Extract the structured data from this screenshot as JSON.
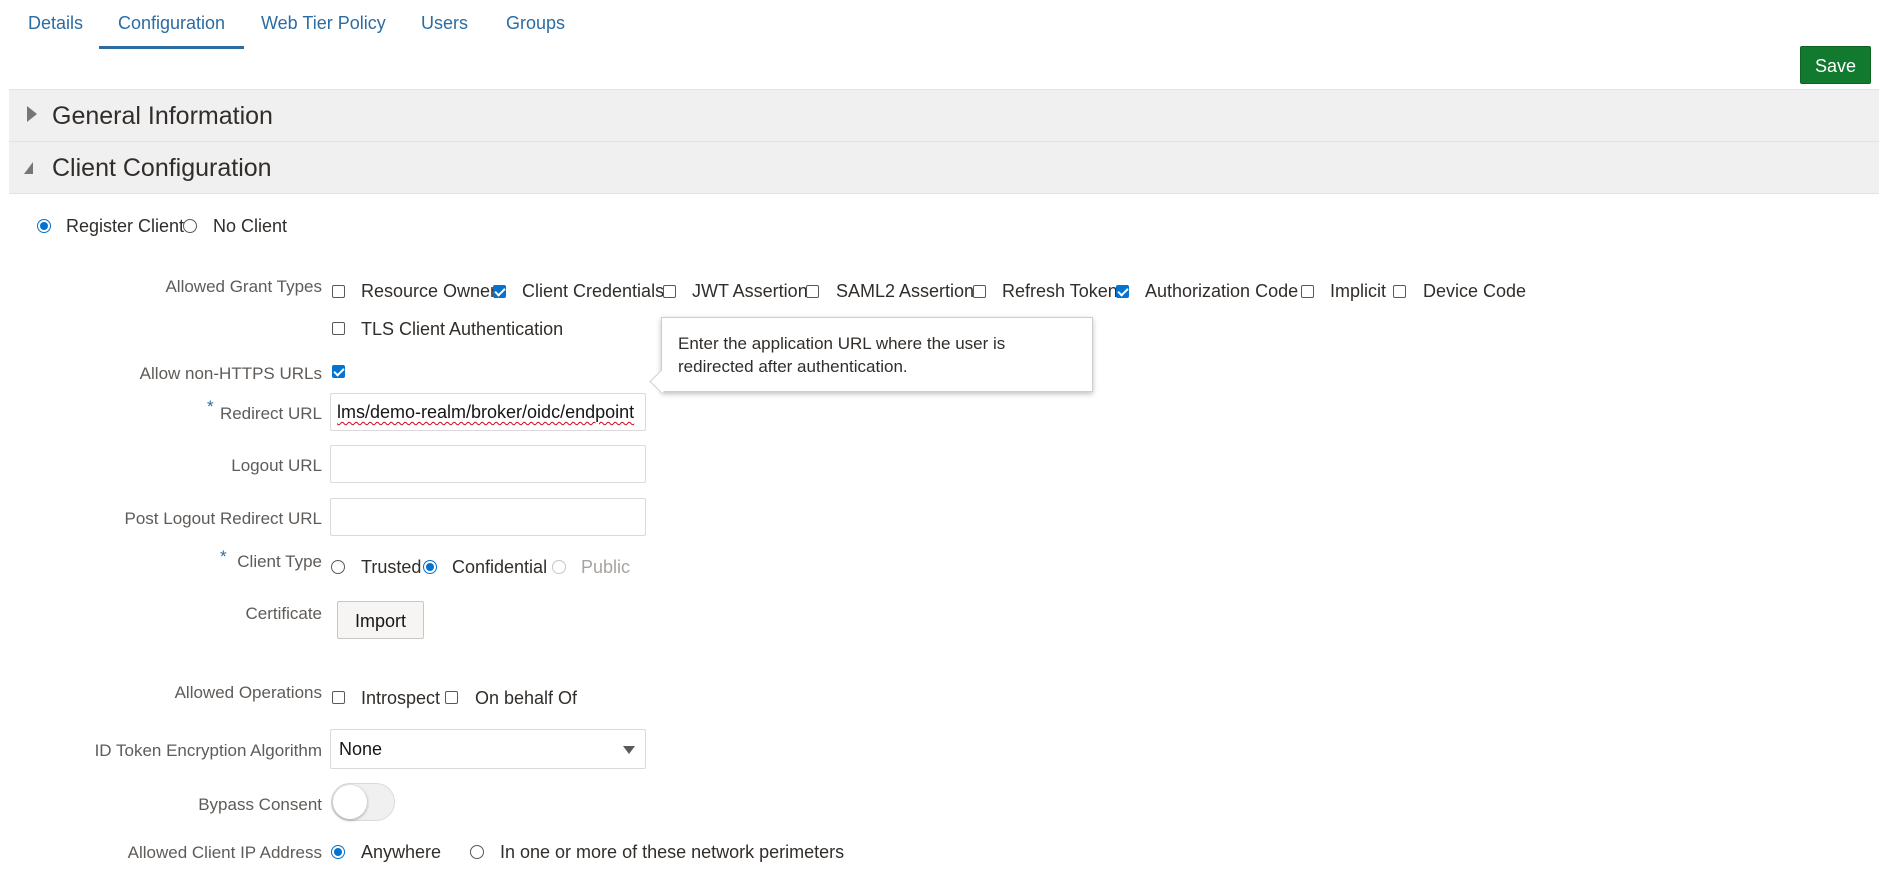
{
  "tabs": [
    {
      "label": "Details",
      "active": false
    },
    {
      "label": "Configuration",
      "active": true
    },
    {
      "label": "Web Tier Policy",
      "active": false
    },
    {
      "label": "Users",
      "active": false
    },
    {
      "label": "Groups",
      "active": false
    }
  ],
  "save_label": "Save",
  "sections": {
    "general": {
      "title": "General Information",
      "expanded": false
    },
    "client": {
      "title": "Client Configuration",
      "expanded": true
    }
  },
  "registration": {
    "register_client": {
      "label": "Register Client",
      "checked": true
    },
    "no_client": {
      "label": "No Client",
      "checked": false
    }
  },
  "grant_types": {
    "label": "Allowed Grant Types",
    "options": [
      {
        "label": "Resource Owner",
        "checked": false
      },
      {
        "label": "Client Credentials",
        "checked": true
      },
      {
        "label": "JWT Assertion",
        "checked": false
      },
      {
        "label": "SAML2 Assertion",
        "checked": false
      },
      {
        "label": "Refresh Token",
        "checked": false
      },
      {
        "label": "Authorization Code",
        "checked": true
      },
      {
        "label": "Implicit",
        "checked": false
      },
      {
        "label": "Device Code",
        "checked": false
      },
      {
        "label": "TLS Client Authentication",
        "checked": false
      }
    ]
  },
  "non_https": {
    "label": "Allow non-HTTPS URLs",
    "checked": true
  },
  "redirect_url": {
    "label": "Redirect URL",
    "required": "*",
    "value": "lms/demo-realm/broker/oidc/endpoint"
  },
  "tooltip": {
    "text": "Enter the application URL where the user is redirected after authentication."
  },
  "logout_url": {
    "label": "Logout URL",
    "value": ""
  },
  "post_logout_url": {
    "label": "Post Logout Redirect URL",
    "value": ""
  },
  "client_type": {
    "label": "Client Type",
    "required": "*",
    "options": [
      {
        "label": "Trusted",
        "checked": false,
        "disabled": false
      },
      {
        "label": "Confidential",
        "checked": true,
        "disabled": false
      },
      {
        "label": "Public",
        "checked": false,
        "disabled": true
      }
    ]
  },
  "certificate": {
    "label": "Certificate",
    "button": "Import"
  },
  "operations": {
    "label": "Allowed Operations",
    "options": [
      {
        "label": "Introspect",
        "checked": false
      },
      {
        "label": "On behalf Of",
        "checked": false
      }
    ]
  },
  "id_token_encryption": {
    "label": "ID Token Encryption Algorithm",
    "value": "None"
  },
  "bypass_consent": {
    "label": "Bypass Consent",
    "on": false
  },
  "client_ip": {
    "label": "Allowed Client IP Address",
    "options": [
      {
        "label": "Anywhere",
        "checked": true
      },
      {
        "label": "In one or more of these network perimeters",
        "checked": false
      }
    ]
  }
}
